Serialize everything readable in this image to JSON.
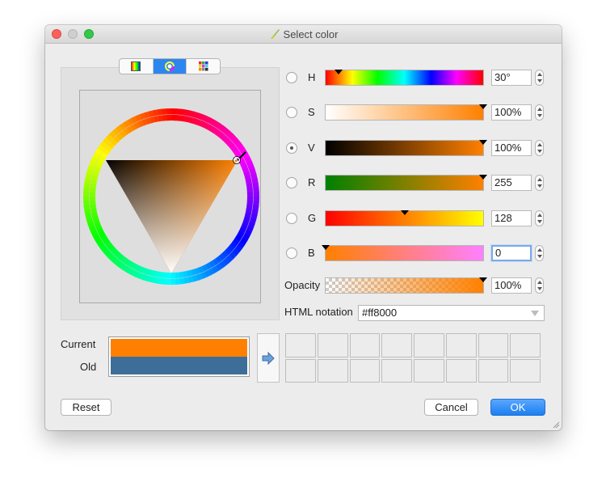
{
  "window": {
    "title": "Select color"
  },
  "tabs": [
    {
      "name": "ramp-tab",
      "active": false
    },
    {
      "name": "wheel-tab",
      "active": true
    },
    {
      "name": "swatch-tab",
      "active": false
    }
  ],
  "components": [
    {
      "key": "H",
      "label": "H",
      "value": "30°",
      "checked": false,
      "marker_fraction": 0.083
    },
    {
      "key": "S",
      "label": "S",
      "value": "100%",
      "checked": false,
      "marker_fraction": 1.0
    },
    {
      "key": "V",
      "label": "V",
      "value": "100%",
      "checked": true,
      "marker_fraction": 1.0
    },
    {
      "key": "R",
      "label": "R",
      "value": "255",
      "checked": false,
      "marker_fraction": 1.0
    },
    {
      "key": "G",
      "label": "G",
      "value": "128",
      "checked": false,
      "marker_fraction": 0.502
    },
    {
      "key": "B",
      "label": "B",
      "value": "0",
      "checked": false,
      "marker_fraction": 0.0
    }
  ],
  "opacity": {
    "label": "Opacity",
    "value": "100%",
    "marker_fraction": 1.0
  },
  "html_notation": {
    "label": "HTML notation",
    "value": "#ff8000"
  },
  "preview": {
    "current_label": "Current",
    "old_label": "Old",
    "current_color": "#ff8000",
    "old_color": "#3d6e99"
  },
  "buttons": {
    "reset": "Reset",
    "cancel": "Cancel",
    "ok": "OK"
  },
  "colors": {
    "accent": "#2d86ef"
  }
}
